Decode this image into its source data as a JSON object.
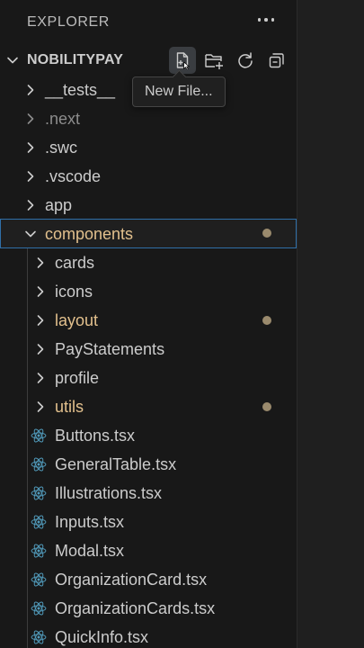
{
  "explorer": {
    "title": "EXPLORER",
    "more_icon": "ellipsis-icon"
  },
  "section": {
    "title": "NOBILITYPAY",
    "actions": [
      {
        "name": "new-file",
        "icon": "new-file-icon"
      },
      {
        "name": "new-folder",
        "icon": "new-folder-icon"
      },
      {
        "name": "refresh",
        "icon": "refresh-icon"
      },
      {
        "name": "collapse-all",
        "icon": "collapse-all-icon"
      }
    ]
  },
  "tooltip": {
    "text": "New File..."
  },
  "tree": {
    "root_items": [
      {
        "label": "__tests__",
        "type": "folder",
        "state": "collapsed"
      },
      {
        "label": ".next",
        "type": "folder",
        "state": "collapsed",
        "dimmed": true
      },
      {
        "label": ".swc",
        "type": "folder",
        "state": "collapsed"
      },
      {
        "label": ".vscode",
        "type": "folder",
        "state": "collapsed"
      },
      {
        "label": "app",
        "type": "folder",
        "state": "collapsed"
      },
      {
        "label": "components",
        "type": "folder",
        "state": "expanded",
        "modified": true,
        "selected": true
      }
    ],
    "component_items": [
      {
        "label": "cards",
        "type": "folder",
        "state": "collapsed"
      },
      {
        "label": "icons",
        "type": "folder",
        "state": "collapsed"
      },
      {
        "label": "layout",
        "type": "folder",
        "state": "collapsed",
        "modified": true
      },
      {
        "label": "PayStatements",
        "type": "folder",
        "state": "collapsed"
      },
      {
        "label": "profile",
        "type": "folder",
        "state": "collapsed"
      },
      {
        "label": "utils",
        "type": "folder",
        "state": "collapsed",
        "modified": true
      },
      {
        "label": "Buttons.tsx",
        "type": "file",
        "icon": "react-icon"
      },
      {
        "label": "GeneralTable.tsx",
        "type": "file",
        "icon": "react-icon"
      },
      {
        "label": "Illustrations.tsx",
        "type": "file",
        "icon": "react-icon"
      },
      {
        "label": "Inputs.tsx",
        "type": "file",
        "icon": "react-icon"
      },
      {
        "label": "Modal.tsx",
        "type": "file",
        "icon": "react-icon"
      },
      {
        "label": "OrganizationCard.tsx",
        "type": "file",
        "icon": "react-icon"
      },
      {
        "label": "OrganizationCards.tsx",
        "type": "file",
        "icon": "react-icon"
      },
      {
        "label": "QuickInfo.tsx",
        "type": "file",
        "icon": "react-icon"
      }
    ]
  },
  "colors": {
    "background": "#181818",
    "text": "#cccccc",
    "modified_text": "#e2c08d",
    "dimmed_text": "#8c8c8c",
    "selection_border": "#2f6fa8",
    "react_icon": "#519aba",
    "modified_dot": "#9a8a6d"
  }
}
